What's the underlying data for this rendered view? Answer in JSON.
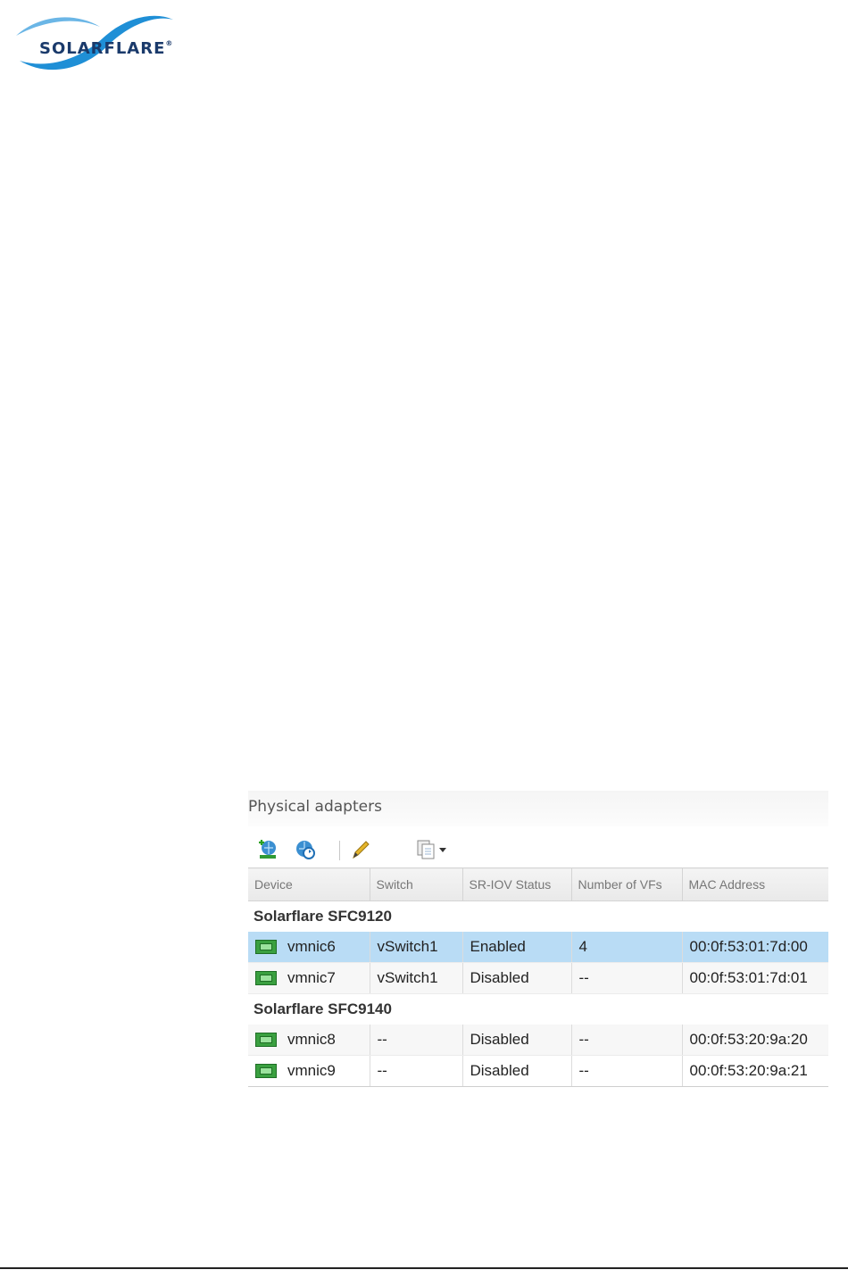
{
  "logo": {
    "text": "SOLARFLARE",
    "registered": "®"
  },
  "panel": {
    "title": "Physical adapters",
    "toolbar": {
      "icons": [
        "add-network-icon",
        "refresh-network-icon",
        "edit-pencil-icon",
        "copy-menu-icon"
      ]
    },
    "columns": [
      "Device",
      "Switch",
      "SR-IOV Status",
      "Number of VFs",
      "MAC Address"
    ],
    "groups": [
      {
        "name": "Solarflare SFC9120",
        "rows": [
          {
            "device": "vmnic6",
            "switch": "vSwitch1",
            "sriov": "Enabled",
            "vfs": "4",
            "mac": "00:0f:53:01:7d:00",
            "selected": true
          },
          {
            "device": "vmnic7",
            "switch": "vSwitch1",
            "sriov": "Disabled",
            "vfs": "--",
            "mac": "00:0f:53:01:7d:01",
            "selected": false
          }
        ]
      },
      {
        "name": "Solarflare SFC9140",
        "rows": [
          {
            "device": "vmnic8",
            "switch": "--",
            "sriov": "Disabled",
            "vfs": "--",
            "mac": "00:0f:53:20:9a:20",
            "selected": false
          },
          {
            "device": "vmnic9",
            "switch": "--",
            "sriov": "Disabled",
            "vfs": "--",
            "mac": "00:0f:53:20:9a:21",
            "selected": false
          }
        ]
      }
    ]
  },
  "colors": {
    "selected_row": "#b9dcf5",
    "logo_blue": "#1a3a6b",
    "logo_swoosh": "#1f8fd6"
  }
}
